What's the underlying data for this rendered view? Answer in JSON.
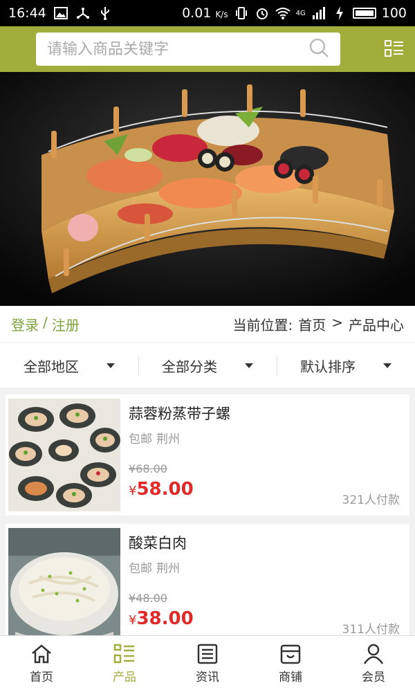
{
  "statusbar": {
    "time": "16:44",
    "speed": "0.01",
    "speed_unit": "K/s",
    "network": "4G",
    "battery": "100"
  },
  "search": {
    "placeholder": "请输入商品关键字"
  },
  "crumbs": {
    "login": "登录",
    "sep": "/",
    "register": "注册",
    "location_label": "当前位置:",
    "home": "首页",
    "arrow": ">",
    "current": "产品中心"
  },
  "filters": [
    {
      "label": "全部地区"
    },
    {
      "label": "全部分类"
    },
    {
      "label": "默认排序"
    }
  ],
  "products": [
    {
      "name": "蒜蓉粉蒸带子螺",
      "shipping": "包邮",
      "city": "荆州",
      "old_price": "¥68.00",
      "price_symbol": "¥",
      "price": "58.00",
      "sold": "321人付款"
    },
    {
      "name": "酸菜白肉",
      "shipping": "包邮",
      "city": "荆州",
      "old_price": "¥48.00",
      "price_symbol": "¥",
      "price": "38.00",
      "sold": "311人付款"
    }
  ],
  "tabs": [
    {
      "label": "首页",
      "icon": "home-icon"
    },
    {
      "label": "产品",
      "icon": "product-list-icon"
    },
    {
      "label": "资讯",
      "icon": "news-icon"
    },
    {
      "label": "商铺",
      "icon": "shop-icon"
    },
    {
      "label": "会员",
      "icon": "user-icon"
    }
  ],
  "colors": {
    "accent": "#a2ae3b",
    "price": "#e02a2a",
    "login": "#7ea33a"
  }
}
